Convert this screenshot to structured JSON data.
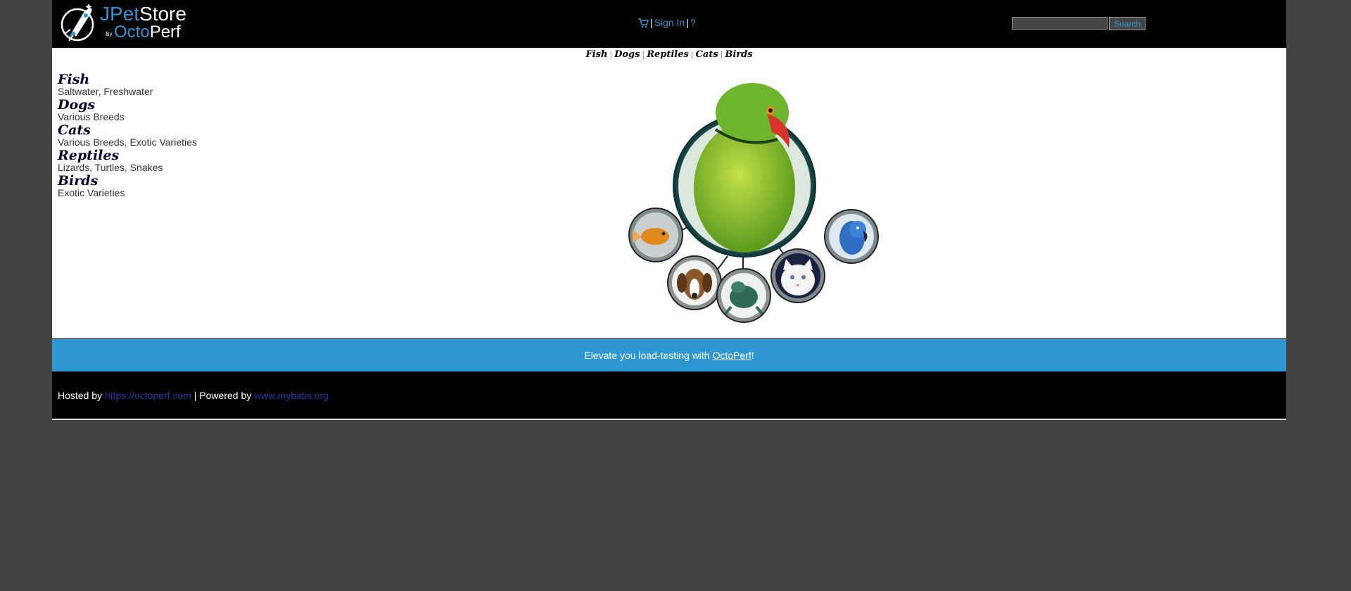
{
  "header": {
    "logo": {
      "word1_a": "JPet",
      "word1_b": "Store",
      "by": "By",
      "word2_a": "Octo",
      "word2_b": "Perf"
    },
    "menu": {
      "sign_in": "Sign In",
      "help": "?",
      "separator": "|"
    },
    "search": {
      "placeholder": "",
      "button": "Search"
    }
  },
  "quicklinks": [
    "Fish",
    "Dogs",
    "Reptiles",
    "Cats",
    "Birds"
  ],
  "sidebar": {
    "categories": [
      {
        "title": "Fish",
        "desc": "Saltwater, Freshwater"
      },
      {
        "title": "Dogs",
        "desc": "Various Breeds"
      },
      {
        "title": "Cats",
        "desc": "Various Breeds, Exotic Varieties"
      },
      {
        "title": "Reptiles",
        "desc": "Lizards, Turtles, Snakes"
      },
      {
        "title": "Birds",
        "desc": "Exotic Varieties"
      }
    ]
  },
  "banner": {
    "prefix": "Elevate you load-testing with ",
    "link": "OctoPerf",
    "suffix": "!"
  },
  "footer": {
    "hosted_by": "Hosted by ",
    "hosted_link": "https://octoperf.com",
    "powered_by": " | Powered by ",
    "powered_link": "www.mybatis.org"
  },
  "colors": {
    "accent": "#2e97d3",
    "background": "#434343",
    "header": "#000000"
  }
}
